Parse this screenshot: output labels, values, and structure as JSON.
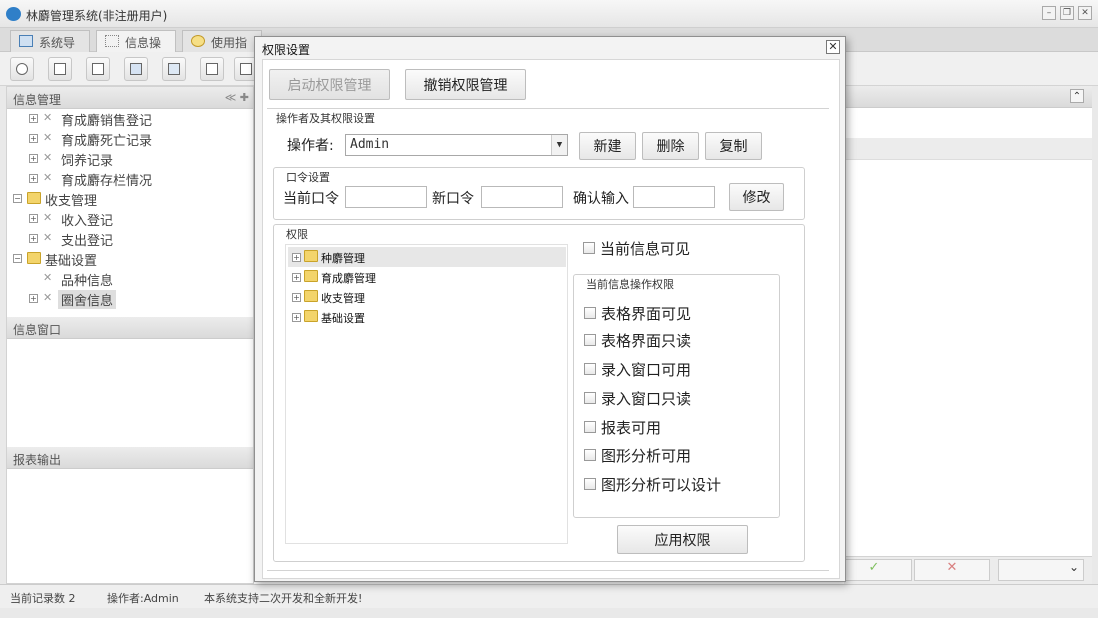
{
  "window": {
    "title": "林麝管理系统(非注册用户)",
    "minimize": "–",
    "restore": "❐",
    "close": "✕"
  },
  "main_tabs": [
    {
      "label": "系统导航"
    },
    {
      "label": "信息操作"
    },
    {
      "label": "使用指南"
    }
  ],
  "sidebar": {
    "panel1_title": "信息管理",
    "panel1_tools": "≪ ✚",
    "tree": [
      {
        "label": "育成麝销售登记",
        "level": 1,
        "type": "leaf"
      },
      {
        "label": "育成麝死亡记录",
        "level": 1,
        "type": "leaf"
      },
      {
        "label": "饲养记录",
        "level": 1,
        "type": "leaf"
      },
      {
        "label": "育成麝存栏情况",
        "level": 1,
        "type": "leaf"
      },
      {
        "label": "收支管理",
        "level": 0,
        "type": "folder"
      },
      {
        "label": "收入登记",
        "level": 1,
        "type": "leaf"
      },
      {
        "label": "支出登记",
        "level": 1,
        "type": "leaf"
      },
      {
        "label": "基础设置",
        "level": 0,
        "type": "folder"
      },
      {
        "label": "品种信息",
        "level": 1,
        "type": "leaf"
      },
      {
        "label": "圈舍信息",
        "level": 1,
        "type": "leaf"
      }
    ],
    "panel2_title": "信息窗口",
    "panel3_title": "报表输出"
  },
  "content": {
    "collapse_icon": "⌃",
    "ok_glyph": "✓",
    "cancel_glyph": "✕",
    "dropdown_arrow": "⌄"
  },
  "status": {
    "record_count": "当前记录数 2",
    "operator": "操作者:Admin",
    "notice": "本系统支持二次开发和全新开发!"
  },
  "dialog": {
    "title": "权限设置",
    "close": "✕",
    "enable_btn": "启动权限管理",
    "revoke_btn": "撤销权限管理",
    "operator_group": "操作者及其权限设置",
    "operator_label": "操作者:",
    "operator_value": "Admin",
    "new_btn": "新建",
    "delete_btn": "删除",
    "copy_btn": "复制",
    "password_group": "口令设置",
    "current_pw_label": "当前口令",
    "new_pw_label": "新口令",
    "confirm_pw_label": "确认输入",
    "modify_btn": "修改",
    "perm_group": "权限",
    "perm_tree": [
      {
        "label": "种麝管理"
      },
      {
        "label": "育成麝管理"
      },
      {
        "label": "收支管理"
      },
      {
        "label": "基础设置"
      }
    ],
    "current_visible": "当前信息可见",
    "ops_group": "当前信息操作权限",
    "ops": [
      {
        "label": "表格界面可见"
      },
      {
        "label": "表格界面只读"
      },
      {
        "label": "录入窗口可用"
      },
      {
        "label": "录入窗口只读"
      },
      {
        "label": "报表可用"
      },
      {
        "label": "图形分析可用"
      },
      {
        "label": "图形分析可以设计"
      }
    ],
    "apply_btn": "应用权限",
    "expander": "+"
  }
}
